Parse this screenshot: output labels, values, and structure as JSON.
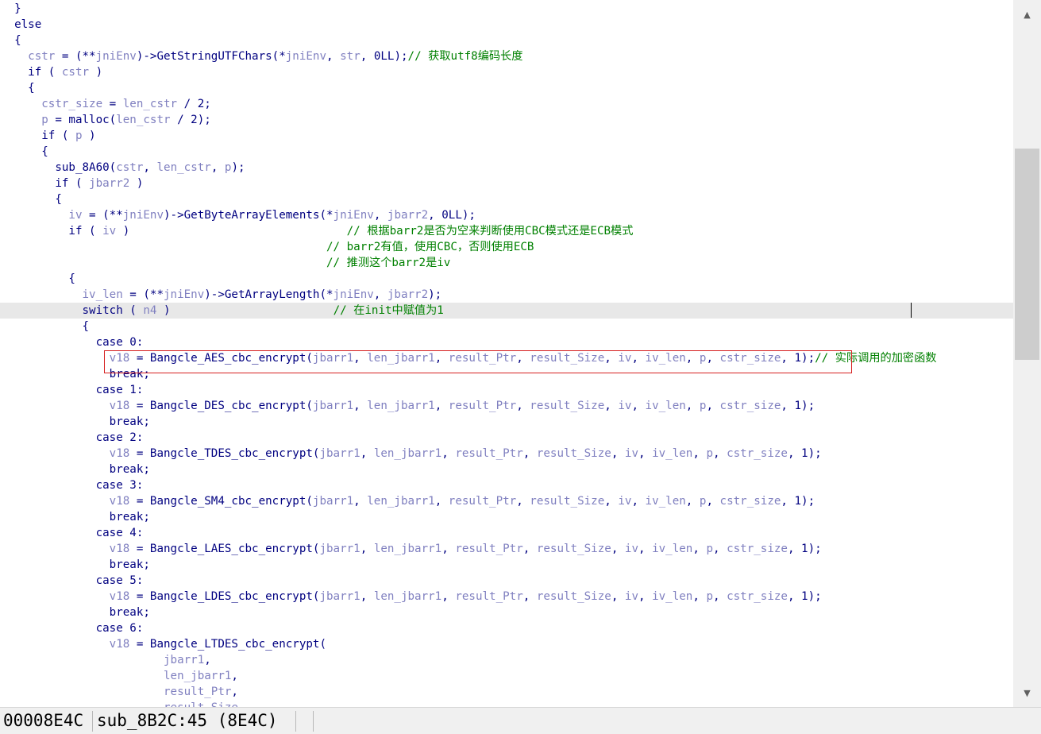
{
  "code_lines": [
    [
      [
        "  }",
        "p"
      ]
    ],
    [
      [
        "  else",
        "kw"
      ]
    ],
    [
      [
        "  {",
        "p"
      ]
    ],
    [
      [
        "    ",
        "p"
      ],
      [
        "cstr",
        "v"
      ],
      [
        " = (**",
        "p"
      ],
      [
        "jniEnv",
        "v"
      ],
      [
        ")->GetStringUTFChars(*",
        "p"
      ],
      [
        "jniEnv",
        "v"
      ],
      [
        ", ",
        "p"
      ],
      [
        "str",
        "v"
      ],
      [
        ", 0LL);",
        "p"
      ],
      [
        "// 获取utf8编码长度",
        "c"
      ]
    ],
    [
      [
        "    if ( ",
        "p"
      ],
      [
        "cstr",
        "v"
      ],
      [
        " )",
        "p"
      ]
    ],
    [
      [
        "    {",
        "p"
      ]
    ],
    [
      [
        "      ",
        "p"
      ],
      [
        "cstr_size",
        "v"
      ],
      [
        " = ",
        "p"
      ],
      [
        "len_cstr",
        "v"
      ],
      [
        " / 2;",
        "p"
      ]
    ],
    [
      [
        "      ",
        "p"
      ],
      [
        "p",
        "v"
      ],
      [
        " = malloc(",
        "p"
      ],
      [
        "len_cstr",
        "v"
      ],
      [
        " / 2);",
        "p"
      ]
    ],
    [
      [
        "      if ( ",
        "p"
      ],
      [
        "p",
        "v"
      ],
      [
        " )",
        "p"
      ]
    ],
    [
      [
        "      {",
        "p"
      ]
    ],
    [
      [
        "        sub_8A60(",
        "p"
      ],
      [
        "cstr",
        "v"
      ],
      [
        ", ",
        "p"
      ],
      [
        "len_cstr",
        "v"
      ],
      [
        ", ",
        "p"
      ],
      [
        "p",
        "v"
      ],
      [
        ");",
        "p"
      ]
    ],
    [
      [
        "        if ( ",
        "p"
      ],
      [
        "jbarr2",
        "v"
      ],
      [
        " )",
        "p"
      ]
    ],
    [
      [
        "        {",
        "p"
      ]
    ],
    [
      [
        "          ",
        "p"
      ],
      [
        "iv",
        "v"
      ],
      [
        " = (**",
        "p"
      ],
      [
        "jniEnv",
        "v"
      ],
      [
        ")->GetByteArrayElements(*",
        "p"
      ],
      [
        "jniEnv",
        "v"
      ],
      [
        ", ",
        "p"
      ],
      [
        "jbarr2",
        "v"
      ],
      [
        ", 0LL);",
        "p"
      ]
    ],
    [
      [
        "          if ( ",
        "p"
      ],
      [
        "iv",
        "v"
      ],
      [
        " )                                ",
        "p"
      ],
      [
        "// 根据barr2是否为空来判断使用CBC模式还是ECB模式",
        "c"
      ]
    ],
    [
      [
        "                                                ",
        "p"
      ],
      [
        "// barr2有值，使用CBC，否则使用ECB",
        "c"
      ]
    ],
    [
      [
        "                                                ",
        "p"
      ],
      [
        "// 推测这个barr2是iv",
        "c"
      ]
    ],
    [
      [
        "          {",
        "p"
      ]
    ],
    [
      [
        "            ",
        "p"
      ],
      [
        "iv_len",
        "v"
      ],
      [
        " = (**",
        "p"
      ],
      [
        "jniEnv",
        "v"
      ],
      [
        ")->GetArrayLength(*",
        "p"
      ],
      [
        "jniEnv",
        "v"
      ],
      [
        ", ",
        "p"
      ],
      [
        "jbarr2",
        "v"
      ],
      [
        ");",
        "p"
      ]
    ],
    [
      [
        "            switch ( ",
        "p"
      ],
      [
        "n4",
        "v"
      ],
      [
        " )                        ",
        "p"
      ],
      [
        "// 在init中赋值为1",
        "c"
      ]
    ],
    [
      [
        "            {",
        "p"
      ]
    ],
    [
      [
        "              case 0:",
        "p"
      ]
    ],
    [
      [
        "                ",
        "p"
      ],
      [
        "v18",
        "v"
      ],
      [
        " = Bangcle_AES_cbc_encrypt(",
        "p"
      ],
      [
        "jbarr1",
        "v"
      ],
      [
        ", ",
        "p"
      ],
      [
        "len_jbarr1",
        "v"
      ],
      [
        ", ",
        "p"
      ],
      [
        "result_Ptr",
        "v"
      ],
      [
        ", ",
        "p"
      ],
      [
        "result_Size",
        "v"
      ],
      [
        ", ",
        "p"
      ],
      [
        "iv",
        "v"
      ],
      [
        ", ",
        "p"
      ],
      [
        "iv_len",
        "v"
      ],
      [
        ", ",
        "p"
      ],
      [
        "p",
        "v"
      ],
      [
        ", ",
        "p"
      ],
      [
        "cstr_size",
        "v"
      ],
      [
        ", 1);",
        "p"
      ],
      [
        "// 实际调用的加密函数",
        "c"
      ]
    ],
    [
      [
        "                break;",
        "p"
      ]
    ],
    [
      [
        "              case 1:",
        "p"
      ]
    ],
    [
      [
        "                ",
        "p"
      ],
      [
        "v18",
        "v"
      ],
      [
        " = Bangcle_DES_cbc_encrypt(",
        "p"
      ],
      [
        "jbarr1",
        "v"
      ],
      [
        ", ",
        "p"
      ],
      [
        "len_jbarr1",
        "v"
      ],
      [
        ", ",
        "p"
      ],
      [
        "result_Ptr",
        "v"
      ],
      [
        ", ",
        "p"
      ],
      [
        "result_Size",
        "v"
      ],
      [
        ", ",
        "p"
      ],
      [
        "iv",
        "v"
      ],
      [
        ", ",
        "p"
      ],
      [
        "iv_len",
        "v"
      ],
      [
        ", ",
        "p"
      ],
      [
        "p",
        "v"
      ],
      [
        ", ",
        "p"
      ],
      [
        "cstr_size",
        "v"
      ],
      [
        ", 1);",
        "p"
      ]
    ],
    [
      [
        "                break;",
        "p"
      ]
    ],
    [
      [
        "              case 2:",
        "p"
      ]
    ],
    [
      [
        "                ",
        "p"
      ],
      [
        "v18",
        "v"
      ],
      [
        " = Bangcle_TDES_cbc_encrypt(",
        "p"
      ],
      [
        "jbarr1",
        "v"
      ],
      [
        ", ",
        "p"
      ],
      [
        "len_jbarr1",
        "v"
      ],
      [
        ", ",
        "p"
      ],
      [
        "result_Ptr",
        "v"
      ],
      [
        ", ",
        "p"
      ],
      [
        "result_Size",
        "v"
      ],
      [
        ", ",
        "p"
      ],
      [
        "iv",
        "v"
      ],
      [
        ", ",
        "p"
      ],
      [
        "iv_len",
        "v"
      ],
      [
        ", ",
        "p"
      ],
      [
        "p",
        "v"
      ],
      [
        ", ",
        "p"
      ],
      [
        "cstr_size",
        "v"
      ],
      [
        ", 1);",
        "p"
      ]
    ],
    [
      [
        "                break;",
        "p"
      ]
    ],
    [
      [
        "              case 3:",
        "p"
      ]
    ],
    [
      [
        "                ",
        "p"
      ],
      [
        "v18",
        "v"
      ],
      [
        " = Bangcle_SM4_cbc_encrypt(",
        "p"
      ],
      [
        "jbarr1",
        "v"
      ],
      [
        ", ",
        "p"
      ],
      [
        "len_jbarr1",
        "v"
      ],
      [
        ", ",
        "p"
      ],
      [
        "result_Ptr",
        "v"
      ],
      [
        ", ",
        "p"
      ],
      [
        "result_Size",
        "v"
      ],
      [
        ", ",
        "p"
      ],
      [
        "iv",
        "v"
      ],
      [
        ", ",
        "p"
      ],
      [
        "iv_len",
        "v"
      ],
      [
        ", ",
        "p"
      ],
      [
        "p",
        "v"
      ],
      [
        ", ",
        "p"
      ],
      [
        "cstr_size",
        "v"
      ],
      [
        ", 1);",
        "p"
      ]
    ],
    [
      [
        "                break;",
        "p"
      ]
    ],
    [
      [
        "              case 4:",
        "p"
      ]
    ],
    [
      [
        "                ",
        "p"
      ],
      [
        "v18",
        "v"
      ],
      [
        " = Bangcle_LAES_cbc_encrypt(",
        "p"
      ],
      [
        "jbarr1",
        "v"
      ],
      [
        ", ",
        "p"
      ],
      [
        "len_jbarr1",
        "v"
      ],
      [
        ", ",
        "p"
      ],
      [
        "result_Ptr",
        "v"
      ],
      [
        ", ",
        "p"
      ],
      [
        "result_Size",
        "v"
      ],
      [
        ", ",
        "p"
      ],
      [
        "iv",
        "v"
      ],
      [
        ", ",
        "p"
      ],
      [
        "iv_len",
        "v"
      ],
      [
        ", ",
        "p"
      ],
      [
        "p",
        "v"
      ],
      [
        ", ",
        "p"
      ],
      [
        "cstr_size",
        "v"
      ],
      [
        ", 1);",
        "p"
      ]
    ],
    [
      [
        "                break;",
        "p"
      ]
    ],
    [
      [
        "              case 5:",
        "p"
      ]
    ],
    [
      [
        "                ",
        "p"
      ],
      [
        "v18",
        "v"
      ],
      [
        " = Bangcle_LDES_cbc_encrypt(",
        "p"
      ],
      [
        "jbarr1",
        "v"
      ],
      [
        ", ",
        "p"
      ],
      [
        "len_jbarr1",
        "v"
      ],
      [
        ", ",
        "p"
      ],
      [
        "result_Ptr",
        "v"
      ],
      [
        ", ",
        "p"
      ],
      [
        "result_Size",
        "v"
      ],
      [
        ", ",
        "p"
      ],
      [
        "iv",
        "v"
      ],
      [
        ", ",
        "p"
      ],
      [
        "iv_len",
        "v"
      ],
      [
        ", ",
        "p"
      ],
      [
        "p",
        "v"
      ],
      [
        ", ",
        "p"
      ],
      [
        "cstr_size",
        "v"
      ],
      [
        ", 1);",
        "p"
      ]
    ],
    [
      [
        "                break;",
        "p"
      ]
    ],
    [
      [
        "              case 6:",
        "p"
      ]
    ],
    [
      [
        "                ",
        "p"
      ],
      [
        "v18",
        "v"
      ],
      [
        " = Bangcle_LTDES_cbc_encrypt(",
        "p"
      ]
    ],
    [
      [
        "                        ",
        "p"
      ],
      [
        "jbarr1",
        "v"
      ],
      [
        ",",
        "p"
      ]
    ],
    [
      [
        "                        ",
        "p"
      ],
      [
        "len_jbarr1",
        "v"
      ],
      [
        ",",
        "p"
      ]
    ],
    [
      [
        "                        ",
        "p"
      ],
      [
        "result_Ptr",
        "v"
      ],
      [
        ",",
        "p"
      ]
    ],
    [
      [
        "                        ",
        "p"
      ],
      [
        "result_Size",
        "v"
      ],
      [
        ",",
        "p"
      ]
    ]
  ],
  "current_line_index": 19,
  "status": {
    "address": "00008E4C",
    "location": "sub_8B2C:45 (8E4C)"
  },
  "colors": {
    "keyword": "#000080",
    "variable": "#8080c0",
    "comment": "#008000",
    "highlight_box": "#d62020",
    "current_line": "#e8e8e8"
  },
  "icons": {
    "scroll_up": "chevron-up-icon",
    "scroll_down": "chevron-down-icon"
  }
}
